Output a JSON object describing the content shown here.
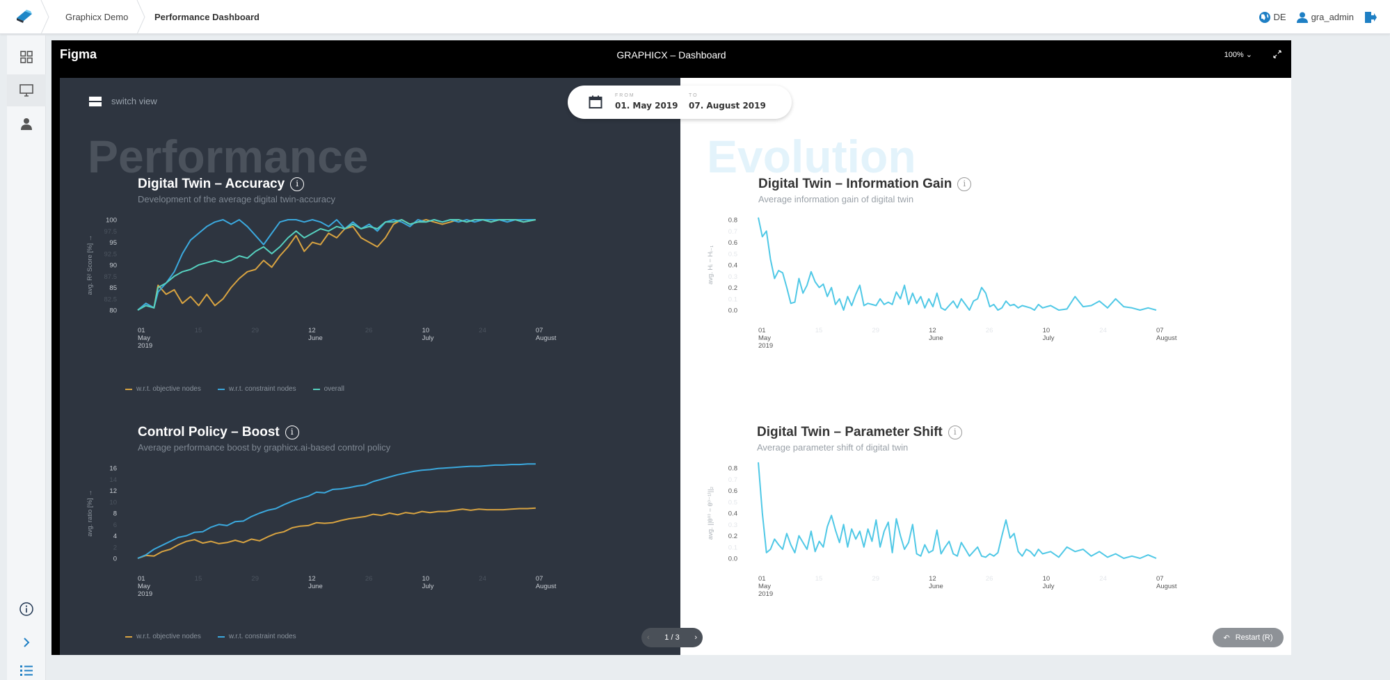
{
  "topbar": {
    "crumbs": [
      "Graphicx Demo",
      "Performance Dashboard"
    ],
    "language": "DE",
    "user": "gra_admin"
  },
  "icons": {
    "logo": "graphicx-logo-icon",
    "language": "globe-icon",
    "user": "user-icon",
    "logout": "logout-icon",
    "rail": [
      "grid-icon",
      "monitor-icon",
      "person-icon",
      "info-icon",
      "chevron-right-icon",
      "list-icon"
    ]
  },
  "frame": {
    "app": "Figma",
    "title": "GRAPHICX – Dashboard",
    "zoom": "100%"
  },
  "dashboard": {
    "switch_view": "switch view",
    "from_label": "FROM",
    "from_value": "01. May 2019",
    "to_label": "TO",
    "to_value": "07. August 2019",
    "left_heading": "Performance",
    "right_heading": "Evolution",
    "pager": "1 / 3",
    "restart": "Restart (R)"
  },
  "colors": {
    "dark_bg": "#2e3540",
    "orange": "#d9a441",
    "blue": "#3ba9de",
    "green": "#56d1bf",
    "cyan": "#4fc8e6"
  },
  "chart_data": [
    {
      "id": "accuracy",
      "type": "line",
      "title": "Digital Twin – Accuracy",
      "subtitle": "Development of the average digital twin-accuracy",
      "ylabel": "avg. R² Score [%] →",
      "ylim": [
        80,
        100
      ],
      "yticks": [
        "80",
        "82.5",
        "85",
        "87.5",
        "90",
        "92.5",
        "95",
        "97.5",
        "100"
      ],
      "xticks": [
        {
          "d": 0,
          "day": "01",
          "month": "May",
          "year": "2019"
        },
        {
          "d": 14,
          "day": "15",
          "month": "",
          "year": ""
        },
        {
          "d": 28,
          "day": "29",
          "month": "",
          "year": ""
        },
        {
          "d": 42,
          "day": "12",
          "month": "June",
          "year": ""
        },
        {
          "d": 56,
          "day": "26",
          "month": "",
          "year": ""
        },
        {
          "d": 70,
          "day": "10",
          "month": "July",
          "year": ""
        },
        {
          "d": 84,
          "day": "24",
          "month": "",
          "year": ""
        },
        {
          "d": 98,
          "day": "07",
          "month": "August",
          "year": ""
        }
      ],
      "x": [
        0,
        2,
        4,
        5,
        7,
        9,
        11,
        13,
        15,
        17,
        19,
        21,
        23,
        25,
        27,
        29,
        31,
        33,
        35,
        37,
        39,
        41,
        43,
        45,
        47,
        49,
        51,
        53,
        55,
        57,
        59,
        61,
        63,
        65,
        67,
        69,
        71,
        73,
        75,
        77,
        79,
        81,
        83,
        85,
        87,
        89,
        91,
        93,
        95,
        98
      ],
      "series": [
        {
          "name": "w.r.t. objective nodes",
          "color": "#d9a441",
          "values": [
            80,
            81.5,
            80.5,
            85.5,
            83.5,
            84.5,
            81.5,
            83,
            81,
            83.5,
            81,
            82.5,
            85,
            87,
            88.5,
            89,
            91,
            89.5,
            92,
            94,
            96.5,
            93,
            95,
            94.5,
            97,
            96,
            98,
            98.5,
            96,
            95,
            94,
            96,
            99,
            100,
            99,
            99.5,
            100,
            99.5,
            99,
            99.5,
            100,
            99.5,
            100,
            100,
            99.5,
            100,
            100,
            100,
            99.5,
            100
          ]
        },
        {
          "name": "w.r.t. constraint nodes",
          "color": "#3ba9de",
          "values": [
            80,
            81.5,
            80.5,
            84,
            86,
            88.5,
            92.5,
            95.5,
            97,
            98.5,
            99.5,
            100,
            99,
            100,
            98.5,
            96.5,
            94.5,
            97,
            99.5,
            100,
            100,
            99.5,
            100,
            99.5,
            98.5,
            100,
            98,
            99.5,
            98,
            99,
            97.5,
            99.5,
            100,
            99.5,
            98.5,
            100,
            99.5,
            100,
            99.5,
            100,
            99.5,
            100,
            99.5,
            100,
            100,
            100,
            99.5,
            100,
            100,
            100
          ]
        },
        {
          "name": "overall",
          "color": "#56d1bf",
          "values": [
            80,
            81,
            80.5,
            85,
            86,
            87.5,
            88.5,
            89,
            90,
            90.5,
            91,
            90.5,
            91,
            92,
            91.5,
            93,
            94,
            92.5,
            94,
            96,
            97.5,
            96,
            97,
            98,
            97.5,
            98.5,
            98,
            99,
            98,
            98.5,
            98,
            99.5,
            99.5,
            100,
            99,
            99.5,
            99.5,
            100,
            99.5,
            100,
            100,
            99.5,
            100,
            100,
            99.5,
            100,
            100,
            100,
            99.5,
            100
          ]
        }
      ]
    },
    {
      "id": "infogain",
      "type": "line",
      "title": "Digital Twin – Information Gain",
      "subtitle": "Average information gain of digital twin",
      "ylabel": "avg. Hᵢ − Hᵢ₋₁",
      "ylim": [
        0,
        0.8
      ],
      "yticks": [
        "0.0",
        "0.1",
        "0.2",
        "0.3",
        "0.4",
        "0.5",
        "0.6",
        "0.7",
        "0.8"
      ],
      "xticks": [
        {
          "d": 0,
          "day": "01",
          "month": "May",
          "year": "2019"
        },
        {
          "d": 14,
          "day": "15",
          "month": "",
          "year": ""
        },
        {
          "d": 28,
          "day": "29",
          "month": "",
          "year": ""
        },
        {
          "d": 42,
          "day": "12",
          "month": "June",
          "year": ""
        },
        {
          "d": 56,
          "day": "26",
          "month": "",
          "year": ""
        },
        {
          "d": 70,
          "day": "10",
          "month": "July",
          "year": ""
        },
        {
          "d": 84,
          "day": "24",
          "month": "",
          "year": ""
        },
        {
          "d": 98,
          "day": "07",
          "month": "August",
          "year": ""
        }
      ],
      "x": [
        0,
        1,
        2,
        3,
        4,
        5,
        6,
        7,
        8,
        9,
        10,
        11,
        12,
        13,
        14,
        15,
        16,
        17,
        18,
        19,
        20,
        21,
        22,
        23,
        24,
        25,
        26,
        27,
        28,
        29,
        30,
        31,
        32,
        33,
        34,
        35,
        36,
        37,
        38,
        39,
        40,
        41,
        42,
        43,
        44,
        45,
        46,
        47,
        48,
        49,
        50,
        51,
        52,
        53,
        54,
        55,
        56,
        57,
        58,
        59,
        60,
        61,
        62,
        63,
        64,
        65,
        66,
        67,
        68,
        69,
        70,
        72,
        74,
        76,
        78,
        80,
        82,
        84,
        86,
        88,
        90,
        92,
        94,
        96,
        98
      ],
      "series": [
        {
          "name": "",
          "color": "#4fc8e6",
          "values": [
            0.82,
            0.65,
            0.7,
            0.45,
            0.28,
            0.35,
            0.33,
            0.2,
            0.06,
            0.07,
            0.28,
            0.15,
            0.22,
            0.34,
            0.25,
            0.2,
            0.23,
            0.12,
            0.2,
            0.05,
            0.1,
            0.0,
            0.12,
            0.04,
            0.14,
            0.22,
            0.04,
            0.06,
            0.05,
            0.04,
            0.1,
            0.05,
            0.07,
            0.05,
            0.16,
            0.1,
            0.22,
            0.05,
            0.15,
            0.06,
            0.12,
            0.02,
            0.1,
            0.03,
            0.15,
            0.02,
            0.0,
            0.04,
            0.08,
            0.02,
            0.1,
            0.05,
            0.0,
            0.08,
            0.1,
            0.2,
            0.15,
            0.03,
            0.05,
            0.0,
            0.02,
            0.08,
            0.04,
            0.05,
            0.02,
            0.04,
            0.03,
            0.02,
            0.0,
            0.05,
            0.02,
            0.04,
            0.0,
            0.01,
            0.12,
            0.03,
            0.04,
            0.08,
            0.02,
            0.1,
            0.03,
            0.02,
            0.0,
            0.02,
            0.0
          ]
        }
      ]
    },
    {
      "id": "boost",
      "type": "line",
      "title": "Control Policy – Boost",
      "subtitle": "Average performance boost by graphicx.ai-based control policy",
      "ylabel": "avg. ratio [%] →",
      "ylim": [
        0,
        16
      ],
      "yticks": [
        "0",
        "2",
        "4",
        "6",
        "8",
        "10",
        "12",
        "14",
        "16"
      ],
      "xticks": [
        {
          "d": 0,
          "day": "01",
          "month": "May",
          "year": "2019"
        },
        {
          "d": 14,
          "day": "15",
          "month": "",
          "year": ""
        },
        {
          "d": 28,
          "day": "29",
          "month": "",
          "year": ""
        },
        {
          "d": 42,
          "day": "12",
          "month": "June",
          "year": ""
        },
        {
          "d": 56,
          "day": "26",
          "month": "",
          "year": ""
        },
        {
          "d": 70,
          "day": "10",
          "month": "July",
          "year": ""
        },
        {
          "d": 84,
          "day": "24",
          "month": "",
          "year": ""
        },
        {
          "d": 98,
          "day": "07",
          "month": "August",
          "year": ""
        }
      ],
      "x": [
        0,
        2,
        4,
        6,
        8,
        10,
        12,
        14,
        16,
        18,
        20,
        22,
        24,
        26,
        28,
        30,
        32,
        34,
        36,
        38,
        40,
        42,
        44,
        46,
        48,
        50,
        52,
        54,
        56,
        58,
        60,
        62,
        64,
        66,
        68,
        70,
        72,
        74,
        76,
        78,
        80,
        82,
        84,
        86,
        88,
        90,
        92,
        94,
        96,
        98
      ],
      "series": [
        {
          "name": "w.r.t. objective nodes",
          "color": "#d9a441",
          "values": [
            0,
            0.5,
            0.4,
            1.2,
            1.6,
            2.4,
            3.0,
            3.3,
            2.7,
            3.0,
            2.6,
            2.8,
            3.2,
            2.8,
            3.4,
            3.1,
            3.8,
            4.4,
            4.7,
            5.4,
            5.7,
            5.8,
            6.3,
            6.2,
            6.3,
            6.7,
            7.0,
            7.2,
            7.4,
            7.8,
            7.6,
            8.0,
            7.7,
            8.1,
            7.9,
            8.3,
            8.1,
            8.3,
            8.3,
            8.5,
            8.7,
            8.5,
            8.7,
            8.6,
            8.6,
            8.6,
            8.7,
            8.8,
            8.8,
            8.9
          ]
        },
        {
          "name": "w.r.t. constraint nodes",
          "color": "#3ba9de",
          "values": [
            0,
            0.6,
            1.6,
            2.3,
            3.0,
            3.7,
            4.0,
            4.6,
            4.7,
            5.5,
            6.0,
            5.8,
            6.5,
            6.6,
            7.4,
            8.0,
            8.5,
            8.8,
            9.5,
            10.1,
            10.6,
            11.0,
            11.7,
            11.6,
            12.2,
            12.3,
            12.5,
            12.8,
            13.0,
            13.6,
            14.0,
            14.4,
            14.8,
            15.1,
            15.4,
            15.6,
            15.7,
            15.9,
            16.0,
            16.1,
            16.2,
            16.3,
            16.3,
            16.4,
            16.5,
            16.5,
            16.6,
            16.6,
            16.7,
            16.7
          ]
        }
      ]
    },
    {
      "id": "paramshift",
      "type": "line",
      "title": "Digital Twin – Parameter Shift",
      "subtitle": "Average parameter shift of digital twin",
      "ylabel": "avg. ||θ⁽ⁱ⁾ − θ⁽ⁱ⁻¹⁾||₂",
      "ylim": [
        0,
        0.8
      ],
      "yticks": [
        "0.0",
        "0.1",
        "0.2",
        "0.3",
        "0.4",
        "0.5",
        "0.6",
        "0.7",
        "0.8"
      ],
      "xticks": [
        {
          "d": 0,
          "day": "01",
          "month": "May",
          "year": "2019"
        },
        {
          "d": 14,
          "day": "15",
          "month": "",
          "year": ""
        },
        {
          "d": 28,
          "day": "29",
          "month": "",
          "year": ""
        },
        {
          "d": 42,
          "day": "12",
          "month": "June",
          "year": ""
        },
        {
          "d": 56,
          "day": "26",
          "month": "",
          "year": ""
        },
        {
          "d": 70,
          "day": "10",
          "month": "July",
          "year": ""
        },
        {
          "d": 84,
          "day": "24",
          "month": "",
          "year": ""
        },
        {
          "d": 98,
          "day": "07",
          "month": "August",
          "year": ""
        }
      ],
      "x": [
        0,
        1,
        2,
        3,
        4,
        5,
        6,
        7,
        8,
        9,
        10,
        11,
        12,
        13,
        14,
        15,
        16,
        17,
        18,
        19,
        20,
        21,
        22,
        23,
        24,
        25,
        26,
        27,
        28,
        29,
        30,
        31,
        32,
        33,
        34,
        35,
        36,
        37,
        38,
        39,
        40,
        41,
        42,
        43,
        44,
        45,
        46,
        47,
        48,
        49,
        50,
        51,
        52,
        53,
        54,
        55,
        56,
        57,
        58,
        59,
        60,
        61,
        62,
        63,
        64,
        65,
        66,
        67,
        68,
        69,
        70,
        72,
        74,
        76,
        78,
        80,
        82,
        84,
        86,
        88,
        90,
        92,
        94,
        96,
        98
      ],
      "series": [
        {
          "name": "",
          "color": "#4fc8e6",
          "values": [
            0.85,
            0.4,
            0.05,
            0.08,
            0.17,
            0.12,
            0.08,
            0.22,
            0.12,
            0.05,
            0.2,
            0.14,
            0.08,
            0.24,
            0.06,
            0.15,
            0.1,
            0.28,
            0.38,
            0.25,
            0.14,
            0.3,
            0.1,
            0.26,
            0.17,
            0.24,
            0.1,
            0.26,
            0.15,
            0.34,
            0.1,
            0.24,
            0.32,
            0.05,
            0.35,
            0.2,
            0.08,
            0.14,
            0.3,
            0.04,
            0.02,
            0.12,
            0.05,
            0.07,
            0.25,
            0.04,
            0.1,
            0.15,
            0.04,
            0.02,
            0.14,
            0.08,
            0.02,
            0.06,
            0.1,
            0.02,
            0.01,
            0.04,
            0.02,
            0.05,
            0.2,
            0.34,
            0.18,
            0.22,
            0.06,
            0.02,
            0.08,
            0.06,
            0.02,
            0.08,
            0.04,
            0.06,
            0.01,
            0.1,
            0.06,
            0.08,
            0.02,
            0.06,
            0.01,
            0.04,
            0.0,
            0.02,
            0.0,
            0.03,
            0.0
          ]
        }
      ]
    }
  ]
}
